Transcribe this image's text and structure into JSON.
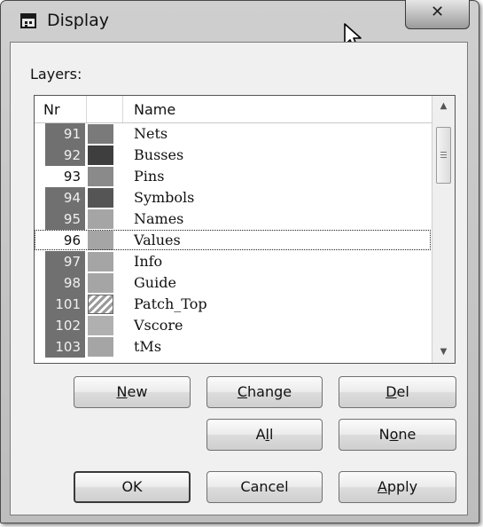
{
  "window": {
    "title": "Display",
    "close_glyph": "✕"
  },
  "layers_label": "Layers:",
  "columns": {
    "nr": "Nr",
    "name": "Name"
  },
  "layers": [
    {
      "nr": "91",
      "name": "Nets",
      "color": "#7a7a7a",
      "active": false,
      "focused": false,
      "pattern": "solid"
    },
    {
      "nr": "92",
      "name": "Busses",
      "color": "#3e3e3e",
      "active": false,
      "focused": false,
      "pattern": "solid"
    },
    {
      "nr": "93",
      "name": "Pins",
      "color": "#8a8a8a",
      "active": true,
      "focused": false,
      "pattern": "solid"
    },
    {
      "nr": "94",
      "name": "Symbols",
      "color": "#555555",
      "active": false,
      "focused": false,
      "pattern": "solid"
    },
    {
      "nr": "95",
      "name": "Names",
      "color": "#a5a5a5",
      "active": false,
      "focused": false,
      "pattern": "solid"
    },
    {
      "nr": "96",
      "name": "Values",
      "color": "#a5a5a5",
      "active": true,
      "focused": true,
      "pattern": "solid"
    },
    {
      "nr": "97",
      "name": "Info",
      "color": "#a5a5a5",
      "active": false,
      "focused": false,
      "pattern": "solid"
    },
    {
      "nr": "98",
      "name": "Guide",
      "color": "#a5a5a5",
      "active": false,
      "focused": false,
      "pattern": "solid"
    },
    {
      "nr": "101",
      "name": "Patch_Top",
      "color": "#9a9a9a",
      "active": false,
      "focused": false,
      "pattern": "hatched"
    },
    {
      "nr": "102",
      "name": "Vscore",
      "color": "#b0b0b0",
      "active": false,
      "focused": false,
      "pattern": "solid"
    },
    {
      "nr": "103",
      "name": "tMs",
      "color": "#a5a5a5",
      "active": false,
      "focused": false,
      "pattern": "solid"
    }
  ],
  "scrollbar": {
    "up_glyph": "▲",
    "down_glyph": "▼"
  },
  "buttons": {
    "new": {
      "before": "",
      "mnemonic": "N",
      "after": "ew"
    },
    "change": {
      "before": "",
      "mnemonic": "C",
      "after": "hange"
    },
    "del": {
      "before": "",
      "mnemonic": "D",
      "after": "el"
    },
    "all": {
      "before": "A",
      "mnemonic": "l",
      "after": "l"
    },
    "none": {
      "before": "N",
      "mnemonic": "o",
      "after": "ne"
    },
    "ok": {
      "label": "OK"
    },
    "cancel": {
      "label": "Cancel"
    },
    "apply": {
      "before": "",
      "mnemonic": "A",
      "after": "pply"
    }
  }
}
